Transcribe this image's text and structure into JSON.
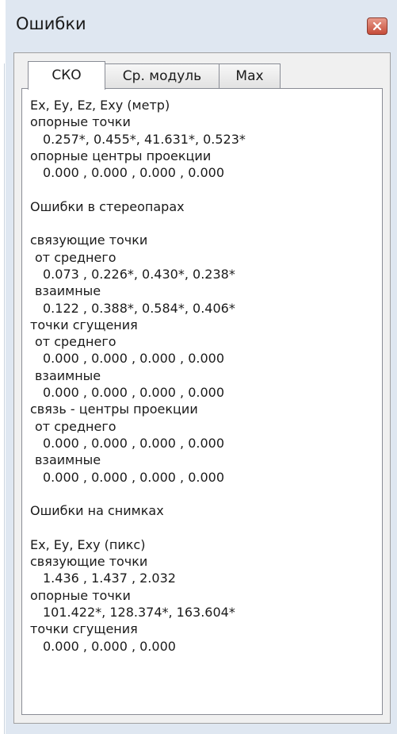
{
  "window": {
    "title": "Ошибки"
  },
  "tabs": [
    {
      "label": "СКО",
      "active": true
    },
    {
      "label": "Ср. модуль",
      "active": false
    },
    {
      "label": "Max",
      "active": false
    }
  ],
  "content": {
    "lines": [
      {
        "text": "Ex, Ey, Ez, Exy (метр)",
        "indent": 0
      },
      {
        "text": "опорные точки",
        "indent": 0
      },
      {
        "text": "0.257*, 0.455*, 41.631*, 0.523*",
        "indent": 2
      },
      {
        "text": "опорные центры проекции",
        "indent": 0
      },
      {
        "text": "0.000 , 0.000 , 0.000 , 0.000",
        "indent": 2
      },
      {
        "text": "",
        "indent": 0
      },
      {
        "text": "Ошибки в стереопарах",
        "indent": 0
      },
      {
        "text": "",
        "indent": 0
      },
      {
        "text": "связующие точки",
        "indent": 0
      },
      {
        "text": "от среднего",
        "indent": 1
      },
      {
        "text": "0.073 , 0.226*, 0.430*, 0.238*",
        "indent": 2
      },
      {
        "text": "взаимные",
        "indent": 1
      },
      {
        "text": "0.122 , 0.388*, 0.584*, 0.406*",
        "indent": 2
      },
      {
        "text": "точки сгущения",
        "indent": 0
      },
      {
        "text": "от среднего",
        "indent": 1
      },
      {
        "text": "0.000 , 0.000 , 0.000 , 0.000",
        "indent": 2
      },
      {
        "text": "взаимные",
        "indent": 1
      },
      {
        "text": "0.000 , 0.000 , 0.000 , 0.000",
        "indent": 2
      },
      {
        "text": "связь - центры проекции",
        "indent": 0
      },
      {
        "text": "от среднего",
        "indent": 1
      },
      {
        "text": "0.000 , 0.000 , 0.000 , 0.000",
        "indent": 2
      },
      {
        "text": "взаимные",
        "indent": 1
      },
      {
        "text": "0.000 , 0.000 , 0.000 , 0.000",
        "indent": 2
      },
      {
        "text": "",
        "indent": 0
      },
      {
        "text": "Ошибки на снимках",
        "indent": 0
      },
      {
        "text": "",
        "indent": 0
      },
      {
        "text": "Ex, Ey, Exy (пикс)",
        "indent": 0
      },
      {
        "text": "связующие точки",
        "indent": 0
      },
      {
        "text": "1.436 , 1.437 , 2.032",
        "indent": 2
      },
      {
        "text": "опорные точки",
        "indent": 0
      },
      {
        "text": "101.422*, 128.374*, 163.604*",
        "indent": 2
      },
      {
        "text": "точки сгущения",
        "indent": 0
      },
      {
        "text": "0.000 , 0.000 , 0.000",
        "indent": 2
      }
    ]
  },
  "icons": {
    "close": "close-icon"
  }
}
